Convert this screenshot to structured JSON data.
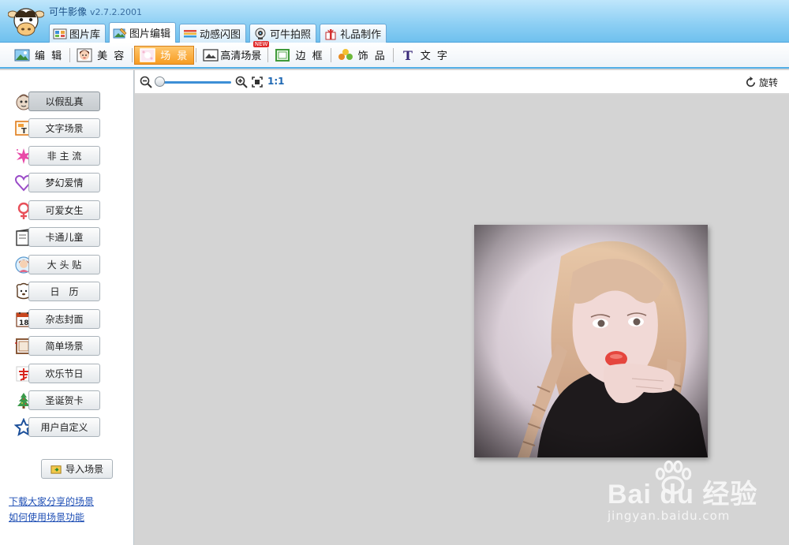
{
  "app": {
    "title": "可牛影像",
    "version": "v2.7.2.2001"
  },
  "main_tabs": [
    {
      "label": "图片库",
      "icon": "photo-library-icon",
      "active": false
    },
    {
      "label": "图片编辑",
      "icon": "photo-edit-icon",
      "active": true
    },
    {
      "label": "动感闪图",
      "icon": "animated-gif-icon",
      "active": false
    },
    {
      "label": "可牛拍照",
      "icon": "webcam-icon",
      "active": false
    },
    {
      "label": "礼品制作",
      "icon": "gift-icon",
      "active": false
    }
  ],
  "toolbar": [
    {
      "label": "编 辑",
      "icon": "edit-landscape-icon",
      "active": false
    },
    {
      "label": "美 容",
      "icon": "beauty-face-icon",
      "active": false
    },
    {
      "label": "场 景",
      "icon": "scene-icon",
      "active": true
    },
    {
      "label": "高清场景",
      "icon": "hd-scene-icon",
      "active": false,
      "badge": "NEW"
    },
    {
      "label": "边 框",
      "icon": "frame-icon",
      "active": false
    },
    {
      "label": "饰 品",
      "icon": "decoration-icon",
      "active": false
    },
    {
      "label": "文 字",
      "icon": "text-icon",
      "active": false
    }
  ],
  "scene_categories": [
    {
      "label": "以假乱真",
      "icon": "realistic-scene-icon",
      "active": true
    },
    {
      "label": "文字场景",
      "icon": "text-scene-icon",
      "active": false
    },
    {
      "label": "非 主 流",
      "icon": "sparkle-star-icon",
      "active": false
    },
    {
      "label": "梦幻爱情",
      "icon": "heart-icon",
      "active": false
    },
    {
      "label": "可爱女生",
      "icon": "female-symbol-icon",
      "active": false
    },
    {
      "label": "卡通儿童",
      "icon": "cartoon-book-icon",
      "active": false
    },
    {
      "label": "大 头 贴",
      "icon": "photo-sticker-icon",
      "active": false
    },
    {
      "label": "日　历",
      "icon": "calendar-dog-icon",
      "active": false
    },
    {
      "label": "杂志封面",
      "icon": "magazine-calendar-icon",
      "active": false
    },
    {
      "label": "简单场景",
      "icon": "simple-frame-icon",
      "active": false
    },
    {
      "label": "欢乐节日",
      "icon": "festival-spring-icon",
      "active": false
    },
    {
      "label": "圣诞贺卡",
      "icon": "christmas-tree-icon",
      "active": false
    },
    {
      "label": "用户自定义",
      "icon": "star-outline-icon",
      "active": false
    }
  ],
  "import_scene": {
    "label": "导入场景",
    "icon": "import-folder-icon"
  },
  "links": {
    "download_shared": "下载大家分享的场景",
    "how_to_use": "如何使用场景功能"
  },
  "zoom": {
    "fit_label": "1:1",
    "level": 0.0
  },
  "rotate": {
    "label": "旋转"
  },
  "watermark": {
    "top": "Bai du 经验",
    "bottom": "jingyan.baidu.com"
  },
  "colors": {
    "accent": "#52aee6",
    "active_tool": "#f79c22",
    "link": "#1f4fb5"
  }
}
